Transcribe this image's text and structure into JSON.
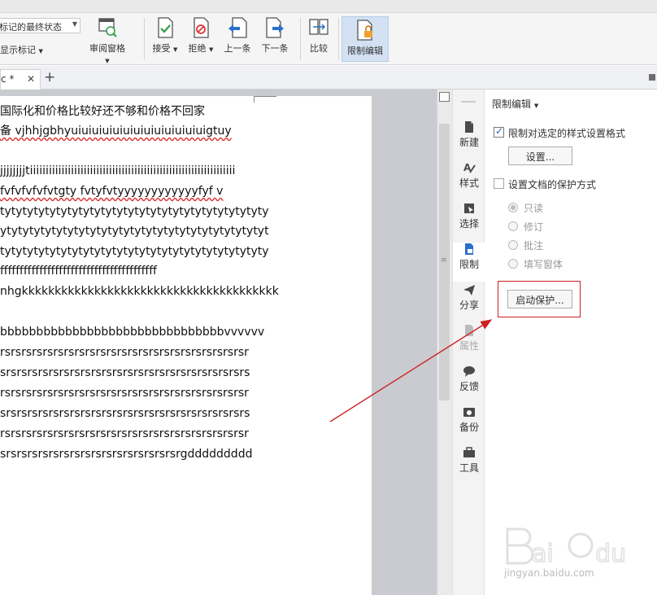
{
  "ribbon": {
    "markup_dropdown": "标记的最终状态",
    "show_markup": "显示标记",
    "review_pane": "审阅窗格",
    "accept": "接受",
    "reject": "拒绝",
    "previous": "上一条",
    "next": "下一条",
    "compare": "比较",
    "restrict_editing": "限制编辑"
  },
  "tabs": {
    "doc_tab_label": "c *",
    "close": "✕",
    "new_tab": "+"
  },
  "document": {
    "lines": [
      {
        "text": "国际化和价格比较好还不够和价格不回家",
        "wavy": false
      },
      {
        "text": "备   vjhhjgbhyuiuiuiuiuiuiuiuiuiuiuiuiuigtuy",
        "wavy": true
      },
      {
        "text": "jjjjjjjjtiiiiiiiiiiiiiiiiiiiiiiiiiiiiiiiiiiiiiiiiiiiiiiiiiiiiiiiiiiiiiiiii",
        "wavy": false
      },
      {
        "text": "fvfvfvfvfvtgty        fvtyfvtyyyyyyyyyyyyfyf        v",
        "wavy": true
      },
      {
        "text": "tytytytytytytytytytytytytytytytytytytytytytytyty",
        "wavy": false
      },
      {
        "text": "ytytytytytytytytytytytytytytytytytytytytytytytyt",
        "wavy": false
      },
      {
        "text": "tytytytytytytytytytytytytytytytytytytytytytytyty",
        "wavy": false
      },
      {
        "text": "ffffffffffffffffffffffffffffffffffffffff",
        "wavy": false
      },
      {
        "text": "nhgkkkkkkkkkkkkkkkkkkkkkkkkkkkkkkkkkkkkkkk",
        "wavy": false
      },
      {
        "text": "bbbbbbbbbbbbbbbbbbbbbbbbbbbbbbbvvvvvv",
        "wavy": false
      },
      {
        "text": "rsrsrsrsrsrsrsrsrsrsrsrsrsrsrsrsrsrsrsrsrsrsrsr",
        "wavy": false
      },
      {
        "text": "srsrsrsrsrsrsrsrsrsrsrsrsrsrsrsrsrsrsrsrsrsrsrs",
        "wavy": false
      },
      {
        "text": "rsrsrsrsrsrsrsrsrsrsrsrsrsrsrsrsrsrsrsrsrsrsrsr",
        "wavy": false
      },
      {
        "text": "srsrsrsrsrsrsrsrsrsrsrsrsrsrsrsrsrsrsrsrsrsrsrs",
        "wavy": false
      },
      {
        "text": "rsrsrsrsrsrsrsrsrsrsrsrsrsrsrsrsrsrsrsrsrsrsrsr",
        "wavy": false
      },
      {
        "text": "srsrsrsrsrsrsrsrsrsrsrsrsrsrsrsrsrgddddddddd",
        "wavy": false
      }
    ]
  },
  "rail": {
    "items": [
      {
        "label": "新建",
        "icon": "new-doc-icon",
        "state": "normal"
      },
      {
        "label": "样式",
        "icon": "style-icon",
        "state": "normal"
      },
      {
        "label": "选择",
        "icon": "select-icon",
        "state": "normal"
      },
      {
        "label": "限制",
        "icon": "restrict-icon",
        "state": "active"
      },
      {
        "label": "分享",
        "icon": "share-icon",
        "state": "normal"
      },
      {
        "label": "属性",
        "icon": "properties-icon",
        "state": "disabled"
      },
      {
        "label": "反馈",
        "icon": "feedback-icon",
        "state": "normal"
      },
      {
        "label": "备份",
        "icon": "backup-icon",
        "state": "normal"
      },
      {
        "label": "工具",
        "icon": "tools-icon",
        "state": "normal"
      }
    ]
  },
  "panel": {
    "title": "限制编辑",
    "format_restrict_label": "限制对选定的样式设置格式",
    "format_restrict_checked": true,
    "settings_button": "设置...",
    "protection_label": "设置文档的保护方式",
    "protection_checked": false,
    "options": [
      {
        "label": "只读",
        "selected": true
      },
      {
        "label": "修订",
        "selected": false
      },
      {
        "label": "批注",
        "selected": false
      },
      {
        "label": "填写窗体",
        "selected": false
      }
    ],
    "start_protection_button": "启动保护..."
  },
  "watermark": {
    "text": "jingyan.baidu.com"
  },
  "colors": {
    "accent_blue": "#2a6fc9",
    "annotation_red": "#cc2222",
    "active_ribbon": "#d3e1f2"
  }
}
